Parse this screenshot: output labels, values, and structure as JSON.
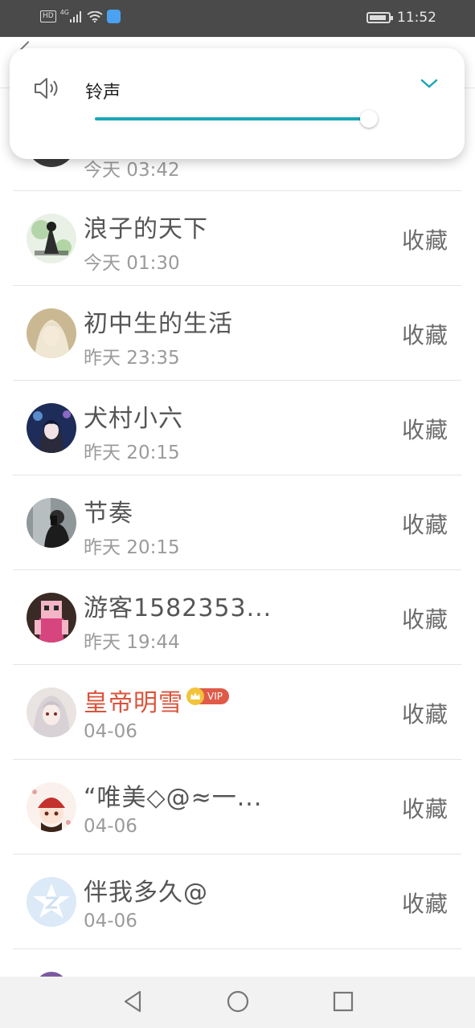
{
  "status_bar": {
    "hd": "HD",
    "network": "4G",
    "time": "11:52"
  },
  "header": {
    "title_partial": "...",
    "colors": {
      "background": "#ffffff"
    }
  },
  "partial_top_item": {
    "time": "今天 03:42"
  },
  "contacts": [
    {
      "name": "浪子的天下",
      "time": "今天 01:30",
      "action": "收藏",
      "avatar": "avatar-ink-painting",
      "vip": false
    },
    {
      "name": "初中生的生活",
      "time": "昨天 23:35",
      "action": "收藏",
      "avatar": "avatar-anime-white-hair",
      "vip": false
    },
    {
      "name": "犬村小六",
      "time": "昨天 20:15",
      "action": "收藏",
      "avatar": "avatar-anime-dark-blue",
      "vip": false
    },
    {
      "name": "节奏",
      "time": "昨天 20:15",
      "action": "收藏",
      "avatar": "avatar-mirror-selfie",
      "vip": false
    },
    {
      "name": "游客1582353...",
      "time": "昨天 19:44",
      "action": "收藏",
      "avatar": "avatar-pixel-character",
      "vip": false
    },
    {
      "name": "皇帝明雪",
      "time": "04-06",
      "action": "收藏",
      "avatar": "avatar-anime-silver",
      "vip": true,
      "vip_label": "VIP"
    },
    {
      "name": "“唯美◇@≈一...",
      "time": "04-06",
      "action": "收藏",
      "avatar": "avatar-chibi-red-hat",
      "vip": false
    },
    {
      "name": "伴我多久@",
      "time": "04-06",
      "action": "收藏",
      "avatar": "avatar-default-qzone",
      "vip": false
    }
  ],
  "volume_popup": {
    "label": "铃声",
    "level": 0.98,
    "colors": {
      "accent": "#1ba7b5"
    }
  },
  "nav_bar": {
    "items": [
      "back-icon",
      "home-icon",
      "recents-icon"
    ]
  }
}
